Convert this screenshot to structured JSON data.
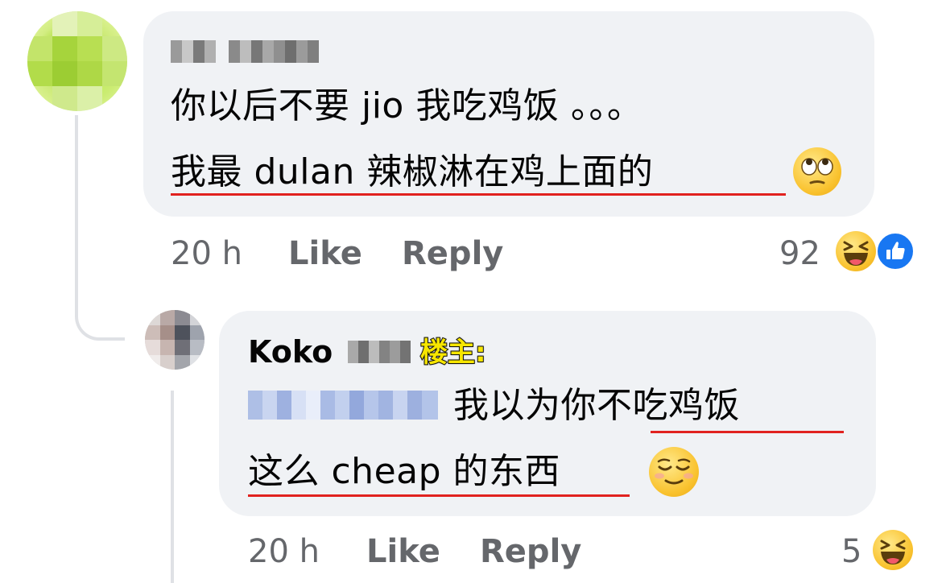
{
  "comment1": {
    "author_name": "",
    "line1": "你以后不要 jio 我吃鸡饭 。。。",
    "line2": "我最 dulan 辣椒淋在鸡上面的",
    "time": "20 h",
    "like_label": "Like",
    "reply_label": "Reply",
    "reaction_count": "92",
    "reactions": [
      "haha-icon",
      "like-icon"
    ]
  },
  "comment2": {
    "author_name": "Koko",
    "author_badge": "楼主:",
    "mention": "",
    "line1": "我以为你不吃鸡饭",
    "line2": "这么 cheap 的东西",
    "time": "20 h",
    "like_label": "Like",
    "reply_label": "Reply",
    "reaction_count": "5",
    "reactions": [
      "haha-icon"
    ]
  },
  "colors": {
    "bubble": "#f0f2f5",
    "meta_text": "#65676b",
    "underline": "#e1221f",
    "badge": "#f7e600",
    "like_blue": "#1877f2"
  }
}
